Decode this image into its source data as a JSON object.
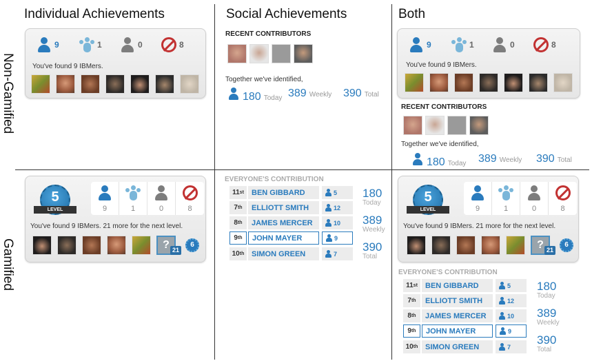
{
  "columns": [
    "Individual Achievements",
    "Social Achievements",
    "Both"
  ],
  "rows": [
    "Non-Gamified",
    "Gamified"
  ],
  "stats": {
    "found": "9",
    "group": "1",
    "ghost": "0",
    "blocked": "8"
  },
  "found_text": "You've found 9 IBMers.",
  "found_text_gamified": "You've found 9 IBMers. 21 more for the next level.",
  "level": {
    "number": "5",
    "label": "LEVEL"
  },
  "next_badge": "6",
  "unknown_badge": {
    "mark": "?",
    "count": "21"
  },
  "recent_contributors_title": "RECENT CONTRIBUTORS",
  "together_text": "Together we've identified,",
  "totals": {
    "today": "180",
    "today_label": "Today",
    "weekly": "389",
    "weekly_label": "Weekly",
    "total": "390",
    "total_label": "Total"
  },
  "everyone_title": "EVERYONE'S CONTRIBUTION",
  "leaderboard": [
    {
      "rank": "11",
      "suffix": "st",
      "name": "BEN GIBBARD",
      "score": "5"
    },
    {
      "rank": "7",
      "suffix": "th",
      "name": "ELLIOTT SMITH",
      "score": "12"
    },
    {
      "rank": "8",
      "suffix": "th",
      "name": "JAMES MERCER",
      "score": "10"
    },
    {
      "rank": "9",
      "suffix": "th",
      "name": "JOHN MAYER",
      "score": "9"
    },
    {
      "rank": "10",
      "suffix": "th",
      "name": "SIMON GREEN",
      "score": "7"
    }
  ],
  "colors": {
    "accent": "#2a7bbd",
    "no_sign": "#c23232",
    "person_grey": "#7d7d7d"
  },
  "icons": [
    "person-icon",
    "group-icon",
    "ghost-person-icon",
    "no-sign-icon"
  ]
}
